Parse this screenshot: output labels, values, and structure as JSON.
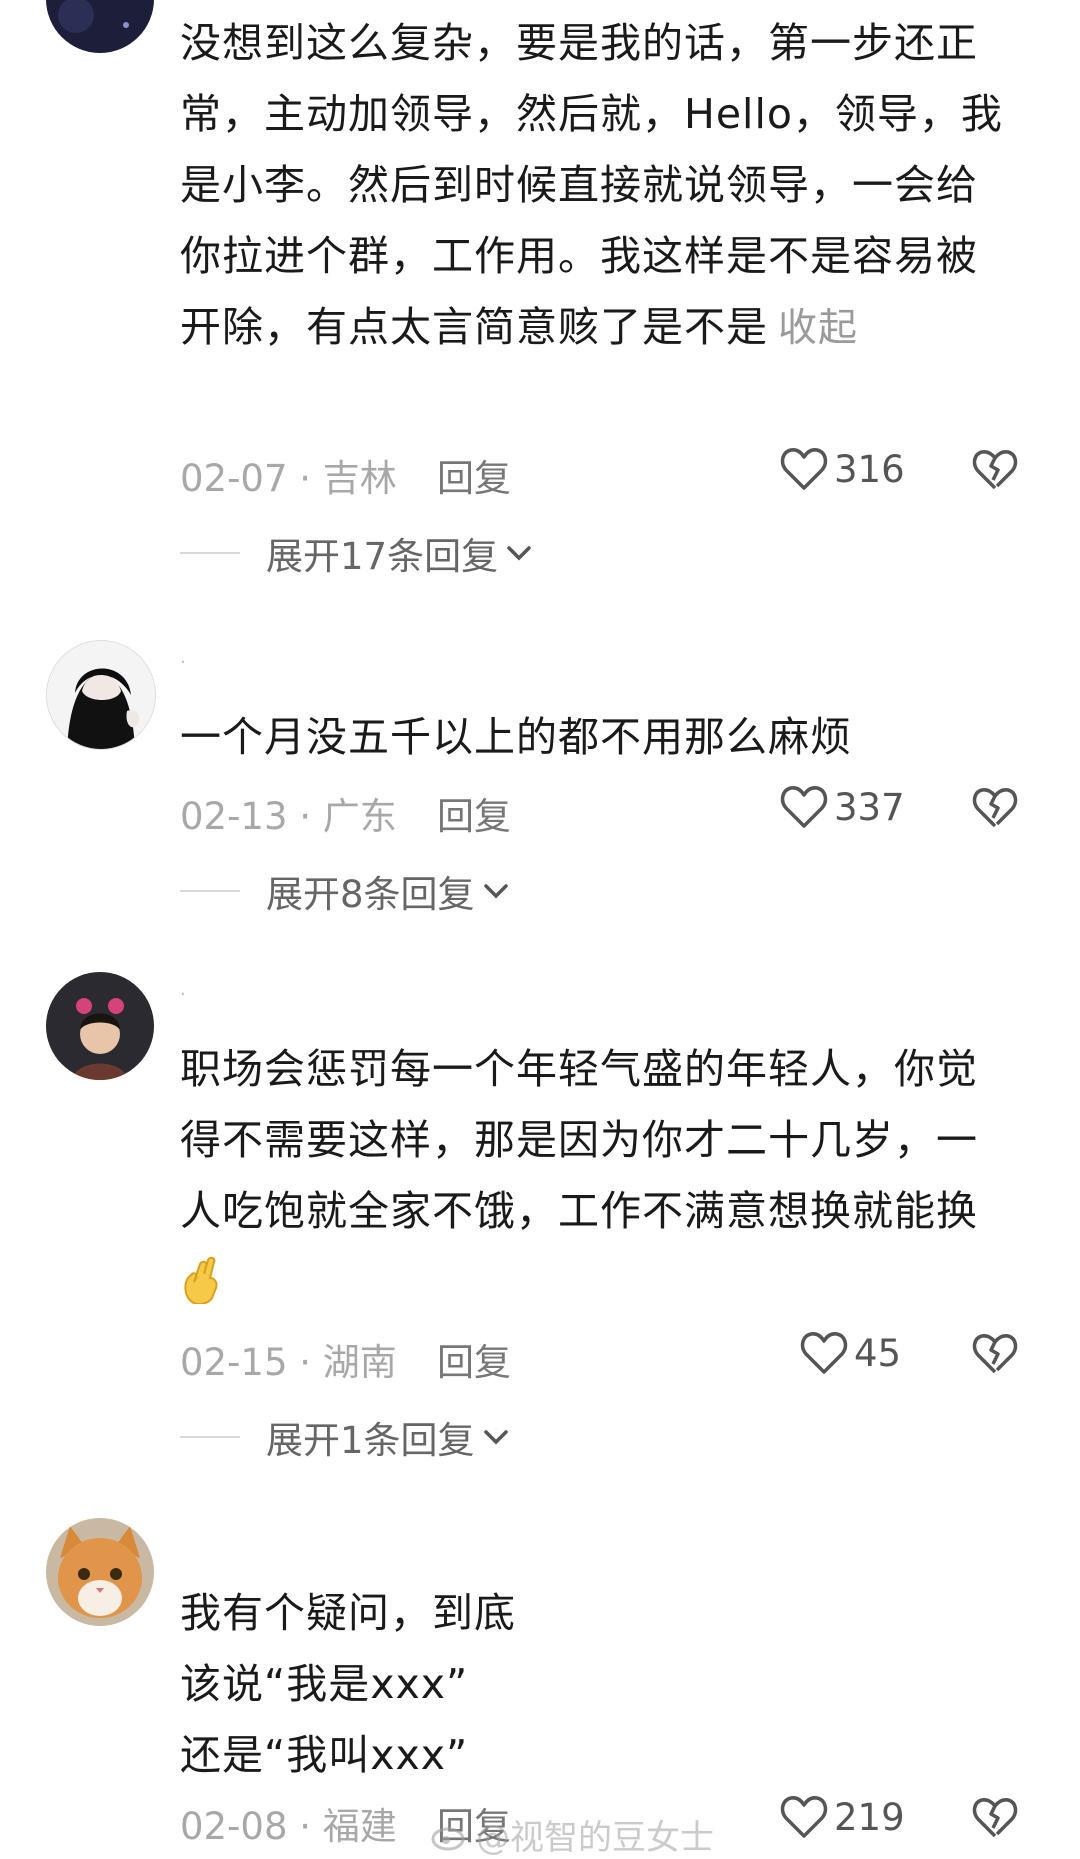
{
  "comments": [
    {
      "text": "没想到这么复杂，要是我的话，第一步还正常，主动加领导，然后就，Hello，领导，我是小李。然后到时候直接就说领导，一会给你拉进个群，工作用。我这样是不是容易被开除，有点太言简意赅了是不是",
      "collapse_label": "收起",
      "date_location": "02-07 · 吉林",
      "reply_label": "回复",
      "likes": "316",
      "expand_label": "展开17条回复"
    },
    {
      "text": "一个月没五千以上的都不用那么麻烦",
      "date_location": "02-13 · 广东",
      "reply_label": "回复",
      "likes": "337",
      "expand_label": "展开8条回复"
    },
    {
      "text": "职场会惩罚每一个年轻气盛的年轻人，你觉得不需要这样，那是因为你才二十几岁，一人吃饱就全家不饿，工作不满意想换就能换",
      "emoji": "crossed-fingers-emoji",
      "date_location": "02-15 · 湖南",
      "reply_label": "回复",
      "likes": "45",
      "expand_label": "展开1条回复"
    },
    {
      "text_lines": [
        "我有个疑问，到底",
        "该说“我是xxx”",
        "还是“我叫xxx”"
      ],
      "date_location": "02-08 · 福建",
      "reply_label": "回复",
      "likes": "219"
    }
  ],
  "watermark": "@视智的豆女士"
}
